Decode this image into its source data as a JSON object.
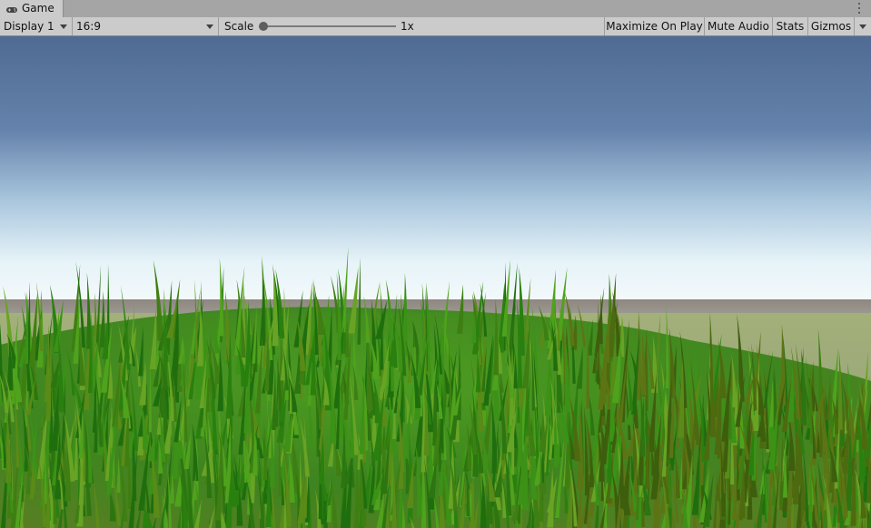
{
  "tab": {
    "title": "Game",
    "icon": "gamepad-icon"
  },
  "toolbar": {
    "display": "Display 1",
    "aspect": "16:9",
    "scale_label": "Scale",
    "scale_value": "1x",
    "scale_level": 0.0,
    "maximize_on_play": "Maximize On Play",
    "mute_audio": "Mute Audio",
    "stats": "Stats",
    "gizmos": "Gizmos"
  },
  "colors": {
    "sky_top": "#4f6b93",
    "sky_horizon": "#eef7fb",
    "ground": "#8f8a84",
    "grass_dark": "#1f6e0e",
    "grass_light": "#5aa321"
  }
}
